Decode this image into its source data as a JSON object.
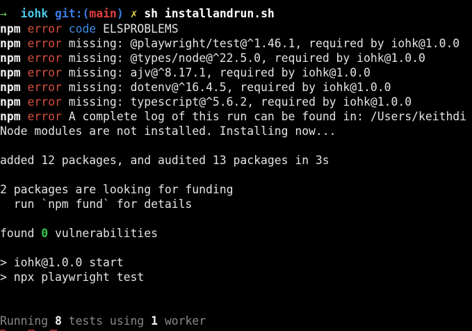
{
  "prompt": {
    "arrow": "→",
    "dir": "iohk",
    "git_label": "git:(",
    "branch": "main",
    "git_close": ")",
    "dirty_mark": "✗",
    "command": "sh installandrun.sh"
  },
  "npm_label": "npm",
  "error_label": "error",
  "code_line": {
    "code_label": "code",
    "code_value": "ELSPROBLEMS"
  },
  "missing_lines": [
    "missing: @playwright/test@^1.46.1, required by iohk@1.0.0",
    "missing: @types/node@^22.5.0, required by iohk@1.0.0",
    "missing: ajv@^8.17.1, required by iohk@1.0.0",
    "missing: dotenv@^16.4.5, required by iohk@1.0.0",
    "missing: typescript@^5.6.2, required by iohk@1.0.0"
  ],
  "log_line": "A complete log of this run can be found in: /Users/keithdi",
  "install_msg": "Node modules are not installed. Installing now...",
  "added_msg": "added 12 packages, and audited 13 packages in 3s",
  "funding_msg": "2 packages are looking for funding",
  "fund_hint": "  run `npm fund` for details",
  "found_prefix": "found ",
  "vuln_count": "0",
  "vuln_suffix": " vulnerabilities",
  "script_start": "> iohk@1.0.0 start",
  "script_cmd": "> npx playwright test",
  "running": {
    "prefix": "Running ",
    "count": "8",
    "mid": " tests using ",
    "workers": "1",
    "suffix": " worker"
  }
}
